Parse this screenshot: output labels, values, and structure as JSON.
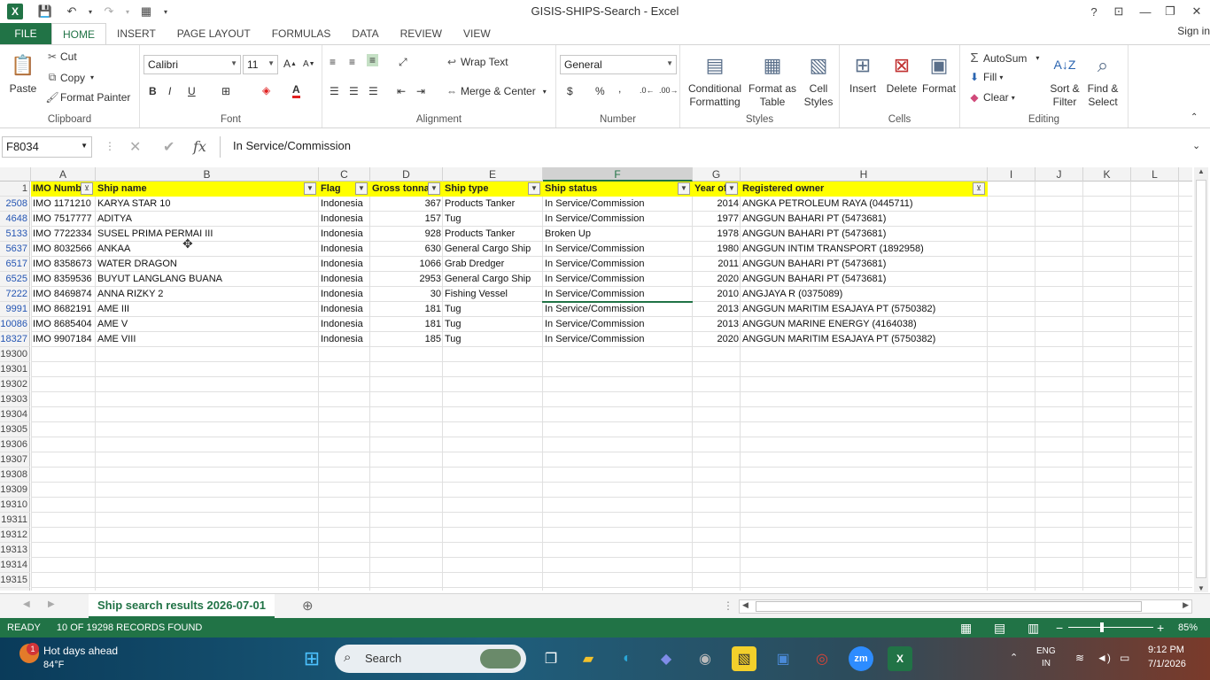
{
  "window": {
    "title": "GISIS-SHIPS-Search - Excel",
    "help": "?",
    "minimize": "—",
    "restore": "❐",
    "close": "✕"
  },
  "ribbon_tabs": [
    "FILE",
    "HOME",
    "INSERT",
    "PAGE LAYOUT",
    "FORMULAS",
    "DATA",
    "REVIEW",
    "VIEW"
  ],
  "sign_in": "Sign in",
  "ribbon": {
    "clipboard": {
      "label": "Clipboard",
      "paste": "Paste",
      "cut": "Cut",
      "copy": "Copy",
      "format_painter": "Format Painter"
    },
    "font": {
      "label": "Font",
      "name": "Calibri",
      "size": "11",
      "bold": "B",
      "italic": "I",
      "underline": "U"
    },
    "alignment": {
      "label": "Alignment",
      "wrap_text": "Wrap Text",
      "merge_center": "Merge & Center"
    },
    "number": {
      "label": "Number",
      "format": "General",
      "currency": "$",
      "percent": "%",
      "comma": ","
    },
    "styles": {
      "label": "Styles",
      "conditional": "Conditional",
      "conditional2": "Formatting",
      "format_table": "Format as",
      "format_table2": "Table",
      "cell_styles": "Cell",
      "cell_styles2": "Styles"
    },
    "cells": {
      "label": "Cells",
      "insert": "Insert",
      "delete": "Delete",
      "format": "Format"
    },
    "editing": {
      "label": "Editing",
      "autosum": "AutoSum",
      "fill": "Fill",
      "clear": "Clear",
      "sort": "Sort &",
      "sort2": "Filter",
      "find": "Find &",
      "find2": "Select"
    }
  },
  "formula_bar": {
    "name_box": "F8034",
    "fx": "fx",
    "content": "In Service/Commission"
  },
  "columns": [
    "A",
    "B",
    "C",
    "D",
    "E",
    "F",
    "G",
    "H",
    "I",
    "J",
    "K",
    "L"
  ],
  "headers": [
    "IMO Numb",
    "Ship name",
    "Flag",
    "Gross tonnag",
    "Ship type",
    "Ship status",
    "Year of",
    "Registered owner"
  ],
  "rows": [
    {
      "row": "2508",
      "imo": "IMO 1171210",
      "name": "KARYA STAR 10",
      "flag": "Indonesia",
      "gt": "367",
      "type": "Products Tanker",
      "status": "In Service/Commission",
      "year": "2014",
      "owner": "ANGKA PETROLEUM RAYA (0445711)"
    },
    {
      "row": "4648",
      "imo": "IMO 7517777",
      "name": "ADITYA",
      "flag": "Indonesia",
      "gt": "157",
      "type": "Tug",
      "status": "In Service/Commission",
      "year": "1977",
      "owner": "ANGGUN BAHARI PT (5473681)"
    },
    {
      "row": "5133",
      "imo": "IMO 7722334",
      "name": "SUSEL PRIMA PERMAI III",
      "flag": "Indonesia",
      "gt": "928",
      "type": "Products Tanker",
      "status": "Broken Up",
      "year": "1978",
      "owner": "ANGGUN BAHARI PT (5473681)"
    },
    {
      "row": "5637",
      "imo": "IMO 8032566",
      "name": "ANKAA",
      "flag": "Indonesia",
      "gt": "630",
      "type": "General Cargo Ship",
      "status": "In Service/Commission",
      "year": "1980",
      "owner": "ANGGUN INTIM TRANSPORT (1892958)"
    },
    {
      "row": "6517",
      "imo": "IMO 8358673",
      "name": "WATER DRAGON",
      "flag": "Indonesia",
      "gt": "1066",
      "type": "Grab Dredger",
      "status": "In Service/Commission",
      "year": "2011",
      "owner": "ANGGUN BAHARI PT (5473681)"
    },
    {
      "row": "6525",
      "imo": "IMO 8359536",
      "name": "BUYUT LANGLANG BUANA",
      "flag": "Indonesia",
      "gt": "2953",
      "type": "General Cargo Ship",
      "status": "In Service/Commission",
      "year": "2020",
      "owner": "ANGGUN BAHARI PT (5473681)"
    },
    {
      "row": "7222",
      "imo": "IMO 8469874",
      "name": "ANNA RIZKY 2",
      "flag": "Indonesia",
      "gt": "30",
      "type": "Fishing Vessel",
      "status": "In Service/Commission",
      "year": "2010",
      "owner": "ANGJAYA R (0375089)"
    },
    {
      "row": "9991",
      "imo": "IMO 8682191",
      "name": "AME III",
      "flag": "Indonesia",
      "gt": "181",
      "type": "Tug",
      "status": "In Service/Commission",
      "year": "2013",
      "owner": "ANGGUN MARITIM ESAJAYA PT (5750382)"
    },
    {
      "row": "10086",
      "imo": "IMO 8685404",
      "name": "AME V",
      "flag": "Indonesia",
      "gt": "181",
      "type": "Tug",
      "status": "In Service/Commission",
      "year": "2013",
      "owner": "ANGGUN MARINE ENERGY (4164038)"
    },
    {
      "row": "18327",
      "imo": "IMO 9907184",
      "name": "AME VIII",
      "flag": "Indonesia",
      "gt": "185",
      "type": "Tug",
      "status": "In Service/Commission",
      "year": "2020",
      "owner": "ANGGUN MARITIM ESAJAYA PT (5750382)"
    }
  ],
  "empty_rows": [
    "19300",
    "19301",
    "19302",
    "19303",
    "19304",
    "19305",
    "19306",
    "19307",
    "19308",
    "19309",
    "19310",
    "19311",
    "19312",
    "19313",
    "19314",
    "19315"
  ],
  "header_row": "1",
  "sheet_tab": "Ship search results 2026-07-01",
  "status": {
    "ready": "READY",
    "records": "10 OF 19298 RECORDS FOUND",
    "zoom": "85%"
  },
  "taskbar": {
    "weather_title": "Hot days ahead",
    "weather_temp": "84°F",
    "badge": "1",
    "search": "Search",
    "lang": "ENG",
    "lang2": "IN",
    "time": "9:12 PM",
    "date": "7/1/2026",
    "zoom_app": "zm"
  },
  "colors": {
    "excel_green": "#217346",
    "header_yellow": "#ffff00",
    "row_blue": "#2455b3"
  }
}
